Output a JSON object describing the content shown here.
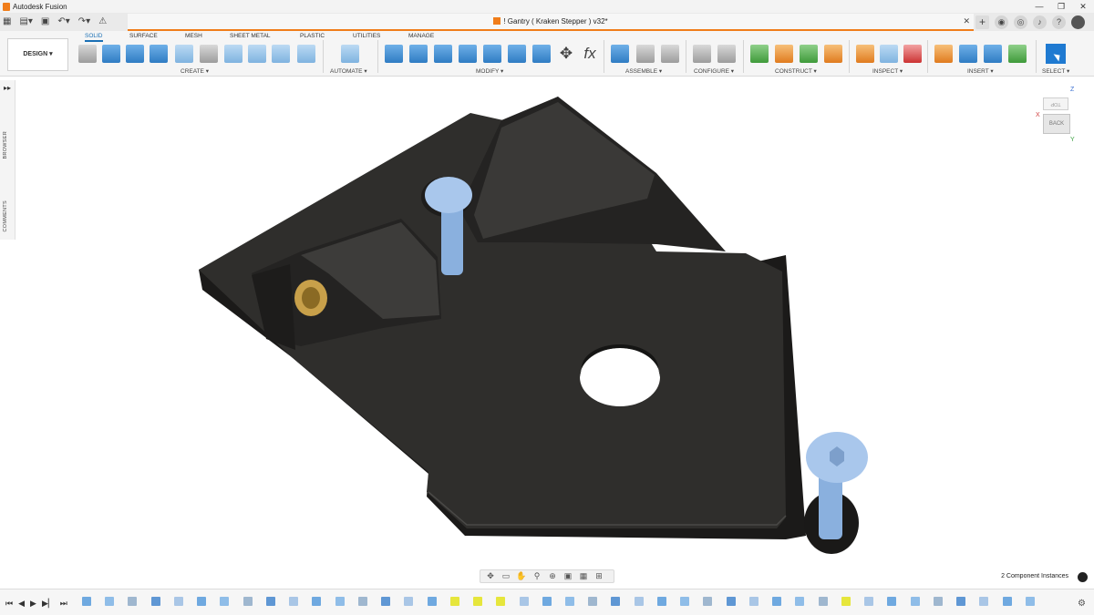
{
  "app": {
    "title": "Autodesk Fusion"
  },
  "document": {
    "tab_title": "! Gantry ( Kraken Stepper ) v32*"
  },
  "workspace": {
    "button_label": "DESIGN ▾"
  },
  "ribbon_tabs": [
    {
      "label": "SOLID",
      "active": true
    },
    {
      "label": "SURFACE"
    },
    {
      "label": "MESH"
    },
    {
      "label": "SHEET METAL"
    },
    {
      "label": "PLASTIC"
    },
    {
      "label": "UTILITIES"
    },
    {
      "label": "MANAGE"
    }
  ],
  "tool_groups": [
    {
      "label": "CREATE ▾"
    },
    {
      "label": "AUTOMATE ▾"
    },
    {
      "label": "MODIFY ▾"
    },
    {
      "label": "ASSEMBLE ▾"
    },
    {
      "label": "CONFIGURE ▾"
    },
    {
      "label": "CONSTRUCT ▾"
    },
    {
      "label": "INSPECT ▾"
    },
    {
      "label": "INSERT ▾"
    },
    {
      "label": "SELECT ▾"
    }
  ],
  "modify_glyph": "fx",
  "side_panel": {
    "expand": "▸▸",
    "browser_label": "BROWSER",
    "comments_label": "COMMENTS"
  },
  "view_cube": {
    "top_label": "TOP",
    "face_label": "BACK",
    "axis_x": "X",
    "axis_y": "Y",
    "axis_z": "Z"
  },
  "status": {
    "instances": "2 Component Instances"
  },
  "window_controls": {
    "minimize": "—",
    "maximize": "❐",
    "close": "✕"
  },
  "doc_tab_close": "✕",
  "colors": {
    "accent": "#f07d1a",
    "ribbon_active": "#1a6fb5",
    "part_top": "#2f2e2c",
    "part_side": "#1a1918",
    "bolt": "#8ab0de",
    "insert": "#c8a04a",
    "timeline_highlight": "#e6e63c"
  },
  "icons": [
    "app-grid-icon",
    "file-icon",
    "save-icon",
    "undo-icon",
    "redo-icon",
    "lamp-icon",
    "new-tab-icon",
    "online-status-icon",
    "job-status-icon",
    "notification-bell-icon",
    "help-icon",
    "user-avatar-icon",
    "orbit-icon",
    "look-at-icon",
    "pan-icon",
    "zoom-icon",
    "zoom-window-icon",
    "display-settings-icon",
    "grid-icon",
    "viewports-icon",
    "first-frame-icon",
    "previous-icon",
    "play-icon",
    "next-icon",
    "last-frame-icon",
    "timeline-settings-icon"
  ]
}
